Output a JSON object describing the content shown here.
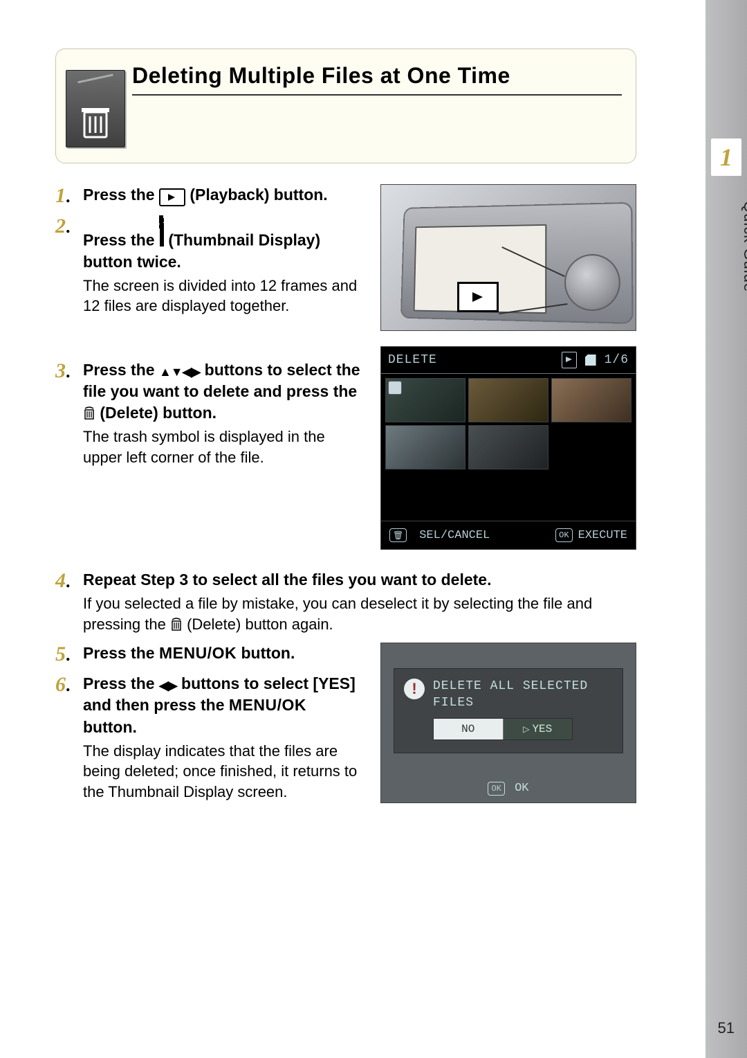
{
  "chapter_number": "1",
  "side_tab_label": "Quick Guide",
  "page_number": "51",
  "title": "Deleting Multiple Files at One Time",
  "steps": [
    {
      "num": "1",
      "title_pre": "Press the ",
      "title_post": " (Playback) button.",
      "desc": ""
    },
    {
      "num": "2",
      "title_pre": "Press the ",
      "title_post": " (Thumbnail Display) button twice.",
      "desc": "The screen is divided into 12 frames and 12 files are displayed together."
    },
    {
      "num": "3",
      "title_pre": "Press the ",
      "title_mid": " buttons to select the file you want to delete and press the ",
      "title_post": " (Delete) button.",
      "desc": "The trash symbol is displayed in the upper left corner of the file."
    },
    {
      "num": "4",
      "title": "Repeat Step 3 to select all the files you want to delete.",
      "desc_pre": "If you selected a file by mistake, you can deselect it by selecting the file and pressing the ",
      "desc_post": " (Delete) button again."
    },
    {
      "num": "5",
      "title_pre": "Press the ",
      "title_mid": "MENU/OK",
      "title_post": " button.",
      "desc": ""
    },
    {
      "num": "6",
      "title_pre": "Press the ",
      "title_mid1": " buttons to select [YES] and then press the ",
      "title_mid2": "MENU/OK",
      "title_post": " button.",
      "desc": "The display indicates that the files are being deleted; once finished, it returns to the Thumbnail Display screen."
    }
  ],
  "fig2": {
    "label_delete": "DELETE",
    "page_indicator": "1/6",
    "sel_cancel": "SEL/CANCEL",
    "execute": "EXECUTE",
    "trash_pill": "🗑",
    "ok_pill": "OK"
  },
  "fig3": {
    "message_line1": "DELETE ALL SELECTED",
    "message_line2": "FILES",
    "opt_no": "NO",
    "opt_yes": "YES",
    "bottom_ok": "OK"
  }
}
